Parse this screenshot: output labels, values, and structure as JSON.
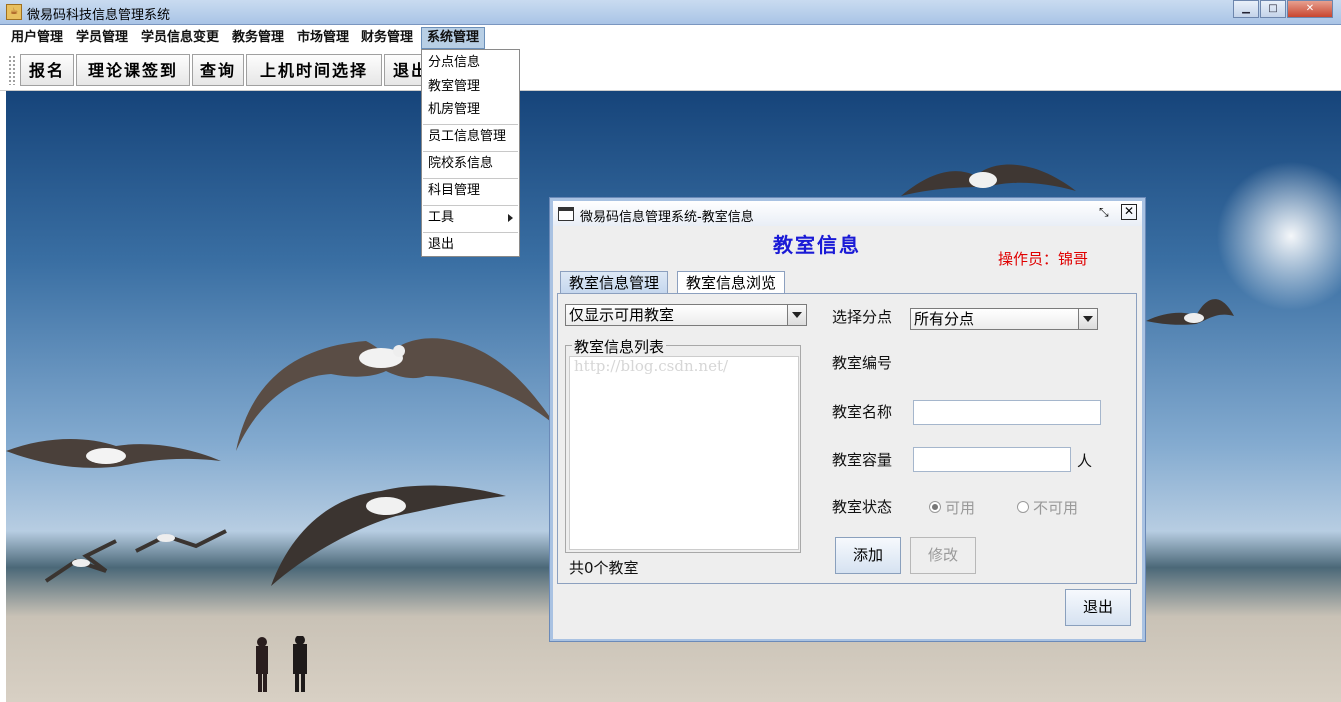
{
  "window": {
    "title": "微易码科技信息管理系统",
    "controls": [
      "minimize-icon",
      "maximize-icon",
      "close-icon"
    ]
  },
  "menubar": {
    "items": [
      "用户管理",
      "学员管理",
      "学员信息变更",
      "教务管理",
      "市场管理",
      "财务管理",
      "系统管理"
    ],
    "active": "系统管理"
  },
  "toolbar": {
    "buttons": [
      "报名",
      "理论课签到",
      "查询",
      "上机时间选择",
      "退出"
    ]
  },
  "system_menu": {
    "items": [
      "分点信息",
      "教室管理",
      "机房管理",
      "员工信息管理",
      "院校系信息",
      "科目管理",
      "工具",
      "退出"
    ]
  },
  "dialog": {
    "title": "微易码信息管理系统-教室信息",
    "heading": "教室信息",
    "operator": "操作员：锦哥",
    "tabs": [
      "教室信息管理",
      "教室信息浏览"
    ],
    "active_tab": "教室信息管理",
    "filter_value": "仅显示可用教室",
    "list_group_title": "教室信息列表",
    "list_watermark": "http://blog.csdn.net/",
    "list_count": "共0个教室",
    "branch_label": "选择分点",
    "branch_value": "所有分点",
    "id_label": "教室编号",
    "name_label": "教室名称",
    "name_value": "",
    "capacity_label": "教室容量",
    "capacity_value": "",
    "capacity_unit": "人",
    "status_label": "教室状态",
    "status_options": [
      "可用",
      "不可用"
    ],
    "status_selected": "可用",
    "add_button": "添加",
    "modify_button": "修改",
    "exit_button": "退出"
  },
  "colors": {
    "heading": "#1a1ad6",
    "operator": "#e00000",
    "menu_highlight": "#b8cfe5"
  }
}
